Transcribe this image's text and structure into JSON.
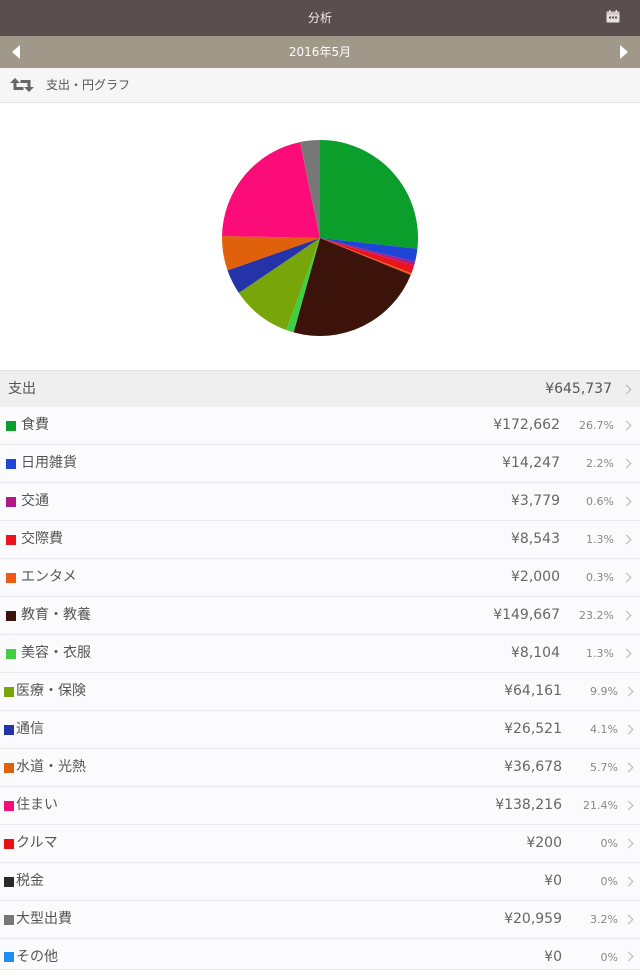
{
  "header": {
    "title": "分析",
    "calendar_icon": "calendar-icon"
  },
  "month_nav": {
    "label": "2016年5月",
    "prev_icon": "triangle-left-icon",
    "next_icon": "triangle-right-icon"
  },
  "mode": {
    "label": "支出・円グラフ",
    "icon": "swap-arrows-icon"
  },
  "total": {
    "label": "支出",
    "amount": "¥645,737"
  },
  "categories": [
    {
      "name": "食費",
      "amount": "¥172,662",
      "percent": "26.7%",
      "color": "#0b9e2b"
    },
    {
      "name": "日用雑貨",
      "amount": "¥14,247",
      "percent": "2.2%",
      "color": "#1f45d6"
    },
    {
      "name": "交通",
      "amount": "¥3,779",
      "percent": "0.6%",
      "color": "#b01a86"
    },
    {
      "name": "交際費",
      "amount": "¥8,543",
      "percent": "1.3%",
      "color": "#e8141e"
    },
    {
      "name": "エンタメ",
      "amount": "¥2,000",
      "percent": "0.3%",
      "color": "#ef5a12"
    },
    {
      "name": "教育・教養",
      "amount": "¥149,667",
      "percent": "23.2%",
      "color": "#3b130b"
    },
    {
      "name": "美容・衣服",
      "amount": "¥8,104",
      "percent": "1.3%",
      "color": "#3fcf45"
    },
    {
      "name": "医療・保険",
      "amount": "¥64,161",
      "percent": "9.9%",
      "color": "#78a60a"
    },
    {
      "name": "通信",
      "amount": "¥26,521",
      "percent": "4.1%",
      "color": "#2433a8"
    },
    {
      "name": "水道・光熱",
      "amount": "¥36,678",
      "percent": "5.7%",
      "color": "#e0600b"
    },
    {
      "name": "住まい",
      "amount": "¥138,216",
      "percent": "21.4%",
      "color": "#fb0c78"
    },
    {
      "name": "クルマ",
      "amount": "¥200",
      "percent": "0%",
      "color": "#ec1111"
    },
    {
      "name": "税金",
      "amount": "¥0",
      "percent": "0%",
      "color": "#2a2a2a"
    },
    {
      "name": "大型出費",
      "amount": "¥20,959",
      "percent": "3.2%",
      "color": "#777777"
    },
    {
      "name": "その他",
      "amount": "¥0",
      "percent": "0%",
      "color": "#1e8ff0"
    }
  ],
  "chart_data": {
    "type": "pie",
    "labels": [
      "食費",
      "日用雑貨",
      "交通",
      "交際費",
      "エンタメ",
      "教育・教養",
      "美容・衣服",
      "医療・保険",
      "通信",
      "水道・光熱",
      "住まい",
      "クルマ",
      "税金",
      "大型出費",
      "その他"
    ],
    "values": [
      172662,
      14247,
      3779,
      8543,
      2000,
      149667,
      8104,
      64161,
      26521,
      36678,
      138216,
      200,
      0,
      20959,
      0
    ],
    "colors": [
      "#0b9e2b",
      "#1f45d6",
      "#b01a86",
      "#e8141e",
      "#ef5a12",
      "#3b130b",
      "#3fcf45",
      "#78a60a",
      "#2433a8",
      "#e0600b",
      "#fb0c78",
      "#ec1111",
      "#2a2a2a",
      "#777777",
      "#1e8ff0"
    ]
  }
}
